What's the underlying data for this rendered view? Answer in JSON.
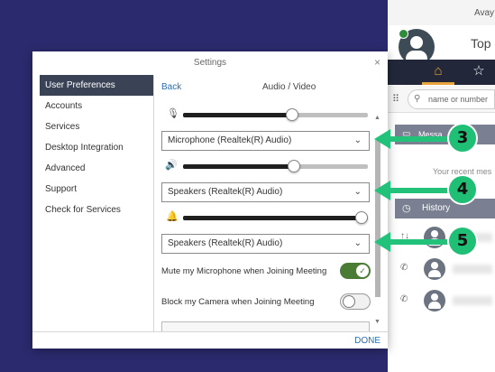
{
  "background_app": {
    "title_partial": "Avay",
    "heading_partial": "Top",
    "search_placeholder": "name or number",
    "messages_label": "Messa",
    "recent_text": "Your recent mes",
    "history_label": "History",
    "home_icon": "home-icon",
    "star_icon": "star-icon"
  },
  "dialog": {
    "title": "Settings",
    "close_glyph": "×",
    "sidebar": [
      {
        "label": "User Preferences",
        "active": true
      },
      {
        "label": "Accounts",
        "active": false
      },
      {
        "label": "Services",
        "active": false
      },
      {
        "label": "Desktop Integration",
        "active": false
      },
      {
        "label": "Advanced",
        "active": false
      },
      {
        "label": "Support",
        "active": false
      },
      {
        "label": "Check for Services",
        "active": false
      }
    ],
    "back_label": "Back",
    "panel_title": "Audio / Video",
    "microphone": {
      "level_percent": 59,
      "device": "Microphone (Realtek(R) Audio)"
    },
    "speakers": {
      "level_percent": 60,
      "device": "Speakers (Realtek(R) Audio)"
    },
    "ringer": {
      "level_percent": 100,
      "device": "Speakers (Realtek(R) Audio)"
    },
    "mute_on_join": {
      "label": "Mute my Microphone when Joining Meeting",
      "on": true
    },
    "block_camera_on_join": {
      "label": "Block my Camera when Joining Meeting",
      "on": false
    },
    "done_label": "DONE"
  },
  "callouts": [
    "3",
    "4",
    "5"
  ],
  "colors": {
    "page_bg": "#2b2a6e",
    "callout_green": "#22c27a",
    "toggle_on": "#4a7c36",
    "link_blue": "#2a6db3",
    "sidebar_active": "#3a4356"
  }
}
